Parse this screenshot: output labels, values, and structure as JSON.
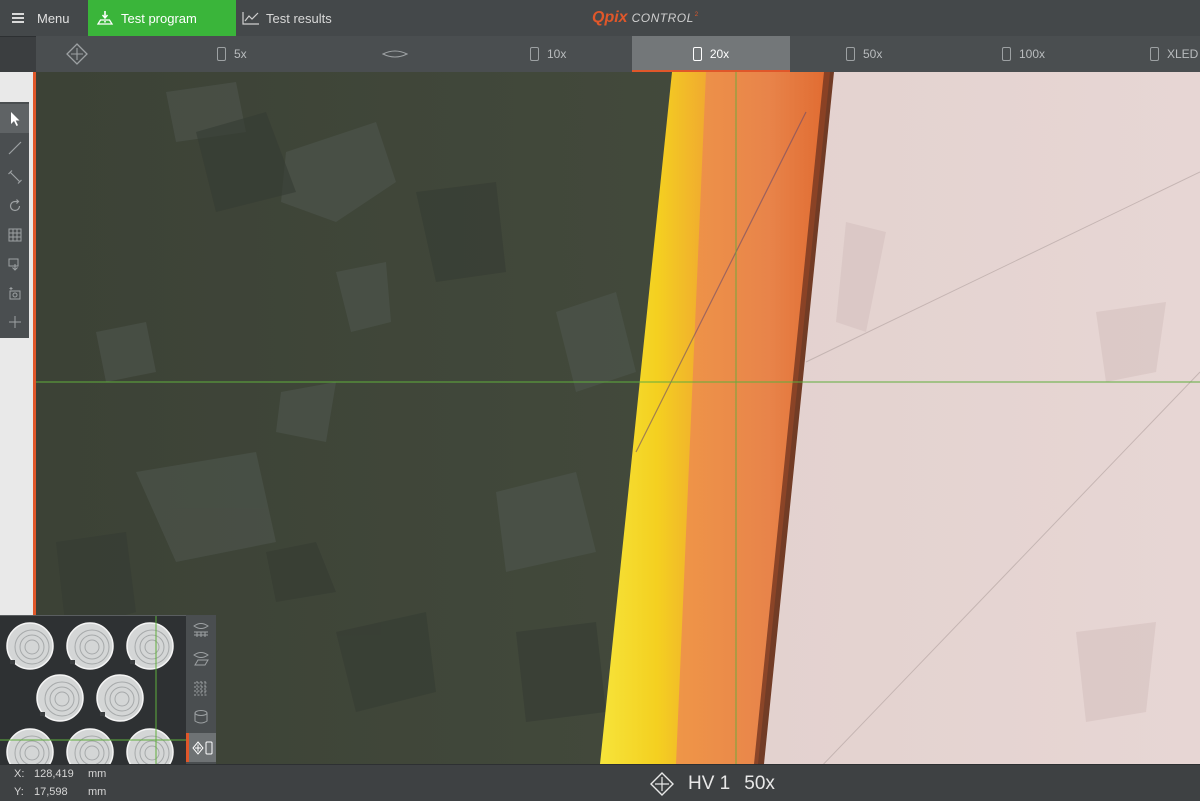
{
  "header": {
    "menu_label": "Menu",
    "tabs": [
      {
        "label": "Test program",
        "active": true
      },
      {
        "label": "Test results",
        "active": false
      }
    ],
    "brand": {
      "q": "Q",
      "pix": "pix",
      "control": "CONTROL",
      "sup": "2"
    }
  },
  "objectives": [
    {
      "label": "5x",
      "active": false
    },
    {
      "label": "10x",
      "active": false
    },
    {
      "label": "20x",
      "active": true
    },
    {
      "label": "50x",
      "active": false
    },
    {
      "label": "100x",
      "active": false
    },
    {
      "label": "XLED",
      "active": false
    }
  ],
  "toolbar": {
    "tools": [
      "pointer-icon",
      "line-icon",
      "distance-icon",
      "rotate-icon",
      "grid-icon",
      "image-download-icon",
      "camera-add-icon",
      "plus-icon"
    ],
    "active_tool": "pointer-icon"
  },
  "minimap": {
    "specimens": 8,
    "tools": [
      "layer-eye-icon",
      "layer-3d-icon",
      "pattern-icon",
      "stack-icon",
      "position-objective-icon"
    ],
    "active_tool": "position-objective-icon"
  },
  "status": {
    "x_label": "X:",
    "x_value": "128,419",
    "x_unit": "mm",
    "y_label": "Y:",
    "y_value": "17,598",
    "y_unit": "mm",
    "indent_label": "HV 1",
    "magnification": "50x"
  },
  "colors": {
    "accent": "#e0572a",
    "active_tab": "#3ab53a",
    "crosshair": "#5fae3c"
  }
}
